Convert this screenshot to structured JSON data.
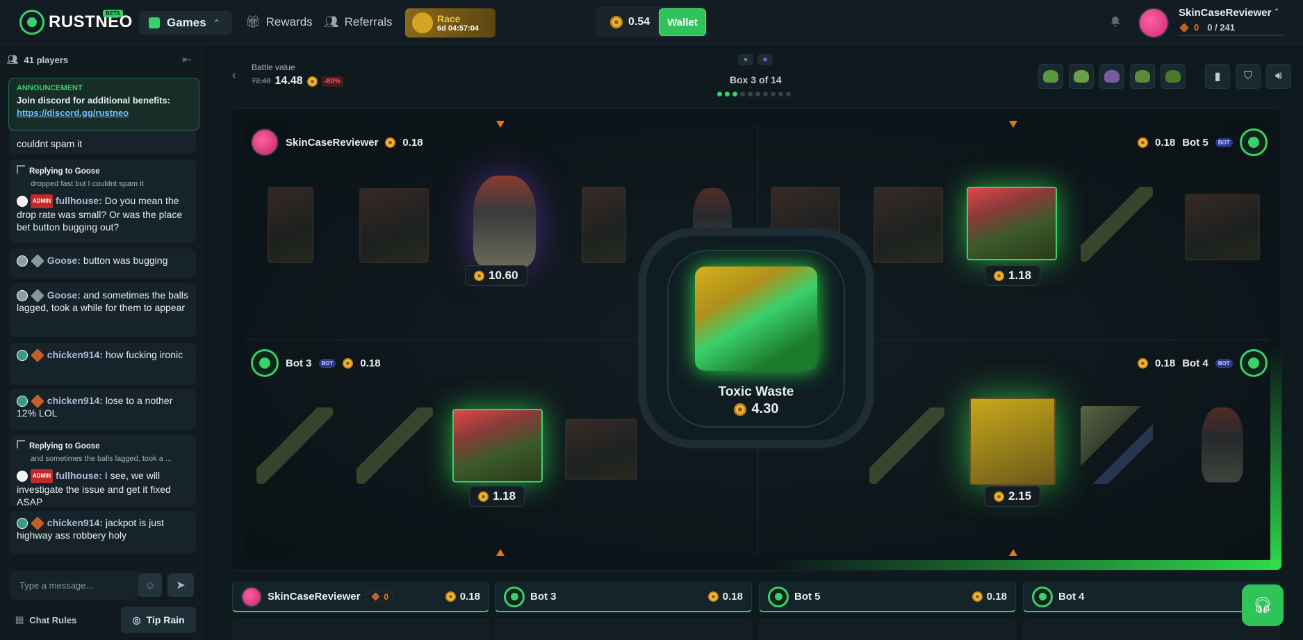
{
  "header": {
    "logo_text": "RUSTNEO",
    "beta_label": "BETA",
    "nav_games": "Games",
    "nav_rewards": "Rewards",
    "nav_referrals": "Referrals",
    "race_label": "Race",
    "race_timer": "6d 04:57:04",
    "balance": "0.54",
    "wallet_label": "Wallet",
    "username": "SkinCaseReviewer",
    "level": "0",
    "xp": "0 / 241"
  },
  "sidebar": {
    "players": "41 players",
    "announcement": {
      "title": "ANNOUNCEMENT",
      "text": "Join discord for additional benefits:",
      "link": "https://discord.gg/rustneo"
    },
    "messages": [
      {
        "text": "couldnt spam it"
      },
      {
        "reply_to": "Replying to Goose",
        "reply_sub": "dropped fast but I couldnt spam it",
        "user": "fullhouse",
        "tag": "ADMIN",
        "text": "Do you mean the drop rate was small? Or was the place bet button bugging out?"
      },
      {
        "user": "Goose",
        "text": "button was bugging"
      },
      {
        "user": "Goose",
        "text": "and sometimes the balls lagged, took a while for them to appear"
      },
      {
        "user": "chicken914",
        "text": "how fucking ironic"
      },
      {
        "user": "chicken914",
        "text": "lose  to a nother 12% LOL"
      },
      {
        "reply_to": "Replying to Goose",
        "reply_sub": "and sometimes the balls lagged, took a ...",
        "user": "fullhouse",
        "tag": "ADMIN",
        "text": "I see, we will investigate the issue and get it fixed ASAP"
      },
      {
        "user": "chicken914",
        "text": "jackpot is just highway ass robbery holy"
      }
    ],
    "input_placeholder": "Type a message...",
    "chat_rules": "Chat Rules",
    "tip_rain": "Tip Rain"
  },
  "battle": {
    "value_label": "Battle value",
    "old_value": "72.40",
    "value": "14.48",
    "discount": "-80%",
    "box_progress": "Box 3 of 14",
    "current_box": 3,
    "total_dots": 10,
    "center_case": "Toxic Waste",
    "center_price": "4.30"
  },
  "players": [
    {
      "name": "SkinCaseReviewer",
      "amount": "0.18",
      "won": "10.60",
      "level": "0"
    },
    {
      "name": "Bot 5",
      "amount": "0.18",
      "won": "1.18",
      "bot_tag": "BOT"
    },
    {
      "name": "Bot 3",
      "amount": "0.18",
      "won": "1.18",
      "bot_tag": "BOT"
    },
    {
      "name": "Bot 4",
      "amount": "0.18",
      "won": "2.15",
      "bot_tag": "BOT"
    }
  ]
}
